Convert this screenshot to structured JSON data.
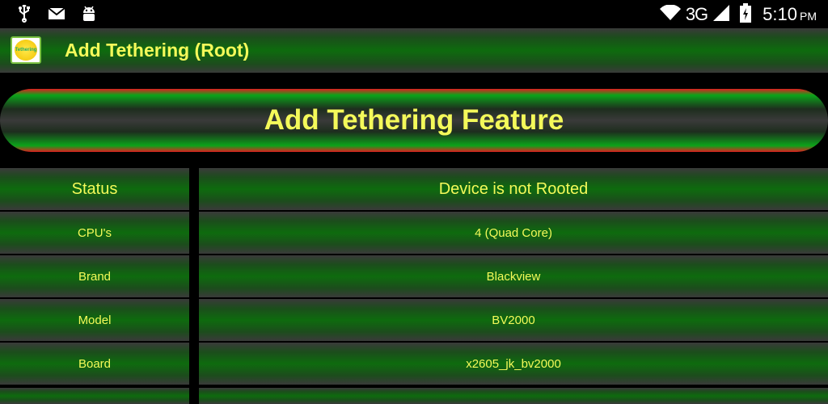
{
  "status_bar": {
    "icons_left": [
      "usb-icon",
      "mail-icon",
      "android-debug-icon"
    ],
    "network": "3G",
    "time": "5:10",
    "ampm": "PM"
  },
  "action_bar": {
    "app_icon_text": "Tethering",
    "title": "Add Tethering (Root)"
  },
  "banner": {
    "label": "Add Tethering Feature"
  },
  "info_rows": [
    {
      "label": "Status",
      "value": "Device is not Rooted"
    },
    {
      "label": "CPU's",
      "value": "4 (Quad Core)"
    },
    {
      "label": "Brand",
      "value": "Blackview"
    },
    {
      "label": "Model",
      "value": "BV2000"
    },
    {
      "label": "Board",
      "value": "x2605_jk_bv2000"
    }
  ],
  "colors": {
    "accent_text": "#f4f95a",
    "bar_green": "#0e6b0e",
    "banner_red": "#e02020",
    "banner_green": "#0ca31a"
  }
}
